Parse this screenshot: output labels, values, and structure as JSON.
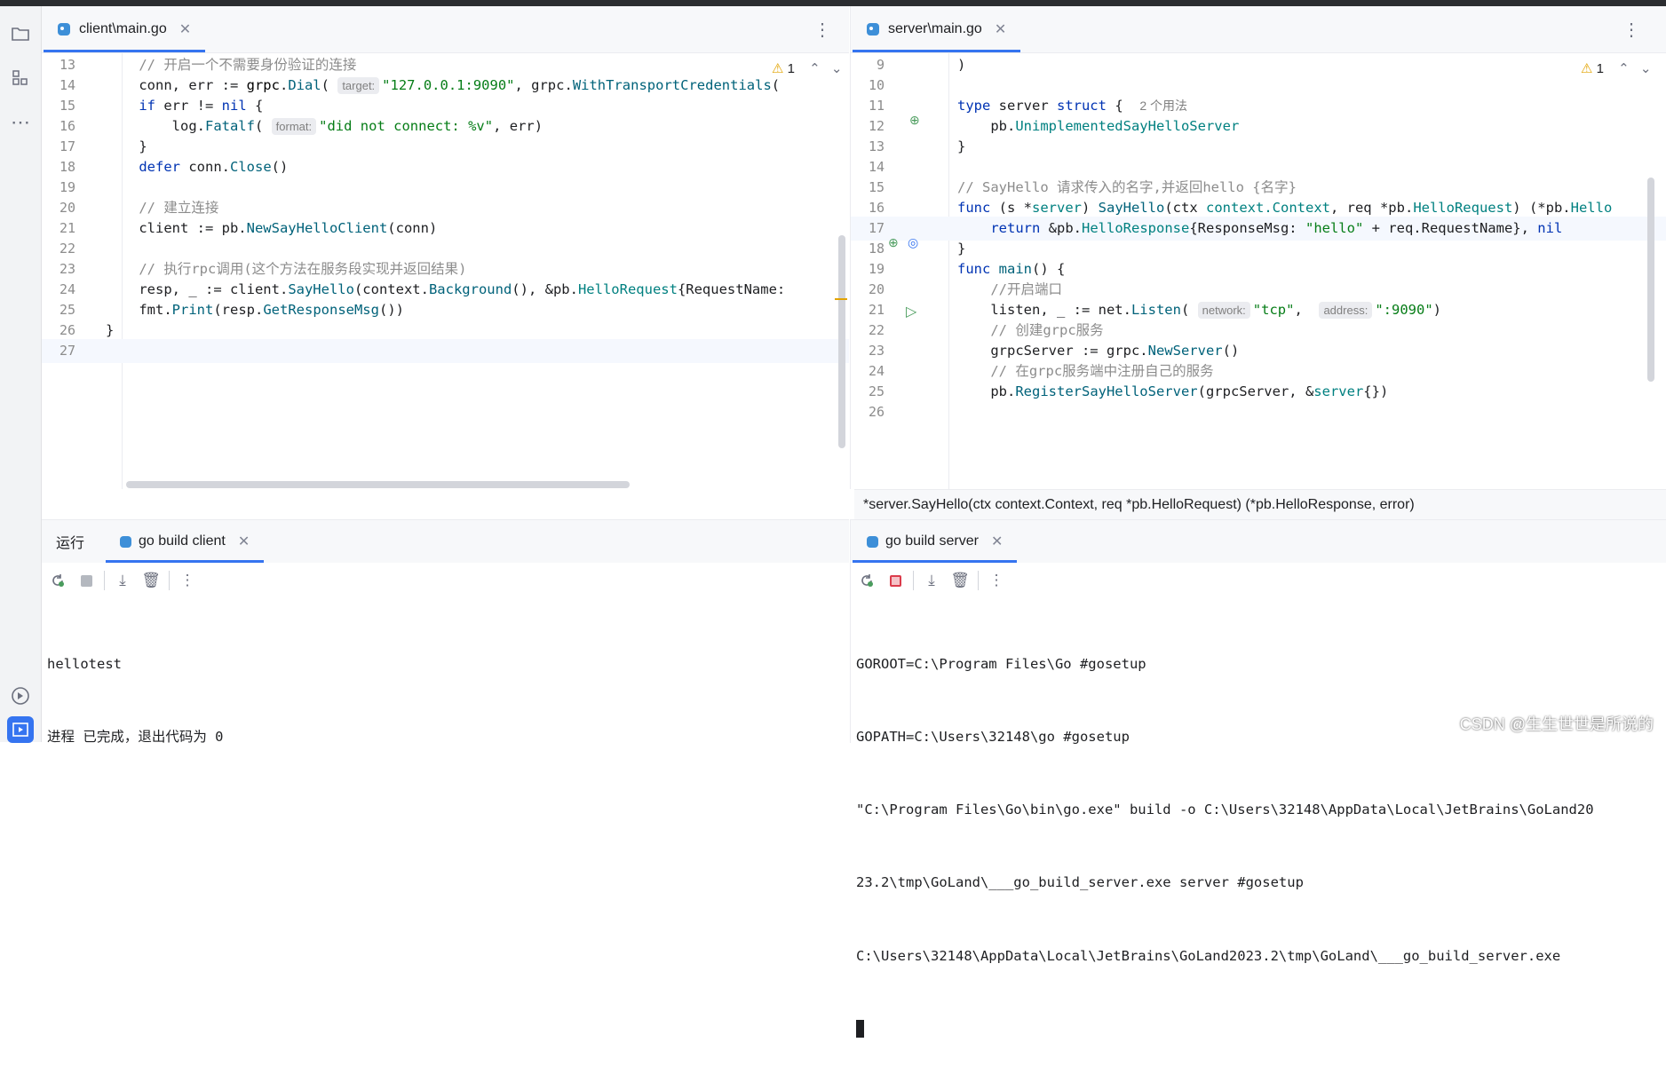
{
  "left_tabs": {
    "active": "client\\main.go"
  },
  "right_tabs": {
    "active": "server\\main.go"
  },
  "left_editor": {
    "warnings": "1",
    "lines": [
      {
        "n": "13",
        "parts": [
          {
            "t": "    ",
            "c": ""
          },
          {
            "t": "// 开启一个不需要身份验证的连接",
            "c": "cm"
          }
        ]
      },
      {
        "n": "14",
        "parts": [
          {
            "t": "    conn, err := ",
            "c": ""
          },
          {
            "t": "grpc",
            "c": "pk"
          },
          {
            "t": ".",
            "c": ""
          },
          {
            "t": "Dial",
            "c": "fn"
          },
          {
            "t": "( ",
            "c": ""
          },
          {
            "h": "target:"
          },
          {
            "t": "\"127.0.0.1:9090\"",
            "c": "str"
          },
          {
            "t": ", grpc.",
            "c": ""
          },
          {
            "t": "WithTransportCredentials",
            "c": "fn"
          },
          {
            "t": "(",
            "c": ""
          }
        ]
      },
      {
        "n": "15",
        "parts": [
          {
            "t": "    ",
            "c": ""
          },
          {
            "t": "if",
            "c": "kw"
          },
          {
            "t": " err != ",
            "c": ""
          },
          {
            "t": "nil",
            "c": "kw"
          },
          {
            "t": " {",
            "c": ""
          }
        ]
      },
      {
        "n": "16",
        "parts": [
          {
            "t": "        log.",
            "c": ""
          },
          {
            "t": "Fatalf",
            "c": "fn"
          },
          {
            "t": "( ",
            "c": ""
          },
          {
            "h": "format:"
          },
          {
            "t": "\"did not connect: %v\"",
            "c": "str"
          },
          {
            "t": ", err)",
            "c": ""
          }
        ]
      },
      {
        "n": "17",
        "parts": [
          {
            "t": "    }",
            "c": ""
          }
        ]
      },
      {
        "n": "18",
        "parts": [
          {
            "t": "    ",
            "c": ""
          },
          {
            "t": "defer",
            "c": "kw"
          },
          {
            "t": " conn.",
            "c": ""
          },
          {
            "t": "Close",
            "c": "fn"
          },
          {
            "t": "()",
            "c": ""
          }
        ]
      },
      {
        "n": "19",
        "parts": []
      },
      {
        "n": "20",
        "parts": [
          {
            "t": "    ",
            "c": ""
          },
          {
            "t": "// 建立连接",
            "c": "cm"
          }
        ]
      },
      {
        "n": "21",
        "parts": [
          {
            "t": "    client := pb.",
            "c": ""
          },
          {
            "t": "NewSayHelloClient",
            "c": "fn"
          },
          {
            "t": "(conn)",
            "c": ""
          }
        ]
      },
      {
        "n": "22",
        "parts": []
      },
      {
        "n": "23",
        "parts": [
          {
            "t": "    ",
            "c": ""
          },
          {
            "t": "// 执行rpc调用(这个方法在服务段实现并返回结果)",
            "c": "cm"
          }
        ]
      },
      {
        "n": "24",
        "parts": [
          {
            "t": "    resp, _ := client.",
            "c": ""
          },
          {
            "t": "SayHello",
            "c": "fn"
          },
          {
            "t": "(context.",
            "c": ""
          },
          {
            "t": "Background",
            "c": "fn"
          },
          {
            "t": "(), &pb.",
            "c": ""
          },
          {
            "t": "HelloRequest",
            "c": "ty"
          },
          {
            "t": "{RequestName:",
            "c": ""
          }
        ]
      },
      {
        "n": "25",
        "parts": [
          {
            "t": "    fmt.",
            "c": ""
          },
          {
            "t": "Print",
            "c": "fn"
          },
          {
            "t": "(resp.",
            "c": ""
          },
          {
            "t": "GetResponseMsg",
            "c": "fn"
          },
          {
            "t": "())",
            "c": ""
          }
        ]
      },
      {
        "n": "26",
        "parts": [
          {
            "t": "}",
            "c": ""
          }
        ]
      },
      {
        "n": "27",
        "parts": [],
        "current": true
      }
    ]
  },
  "right_editor": {
    "warnings": "1",
    "lines": [
      {
        "n": "9",
        "parts": [
          {
            "t": ")",
            "c": ""
          }
        ]
      },
      {
        "n": "10",
        "parts": []
      },
      {
        "n": "11",
        "parts": [
          {
            "t": "type",
            "c": "kw"
          },
          {
            "t": " server ",
            "c": ""
          },
          {
            "t": "struct",
            "c": "kw"
          },
          {
            "t": " {  ",
            "c": ""
          },
          {
            "u": "2 个用法"
          }
        ]
      },
      {
        "n": "12",
        "parts": [
          {
            "t": "    pb.",
            "c": ""
          },
          {
            "t": "UnimplementedSayHelloServer",
            "c": "ty"
          }
        ]
      },
      {
        "n": "13",
        "parts": [
          {
            "t": "}",
            "c": ""
          }
        ]
      },
      {
        "n": "14",
        "parts": []
      },
      {
        "n": "15",
        "parts": [
          {
            "t": "// SayHello 请求传入的名字,并返回hello {名字}",
            "c": "cm"
          }
        ]
      },
      {
        "n": "16",
        "parts": [
          {
            "t": "func",
            "c": "kw"
          },
          {
            "t": " (s *",
            "c": ""
          },
          {
            "t": "server",
            "c": "ty"
          },
          {
            "t": ") ",
            "c": ""
          },
          {
            "t": "SayHello",
            "c": "fn"
          },
          {
            "t": "(ctx ",
            "c": ""
          },
          {
            "t": "context.Context",
            "c": "ty"
          },
          {
            "t": ", req *pb.",
            "c": ""
          },
          {
            "t": "HelloRequest",
            "c": "ty"
          },
          {
            "t": ") (*pb.",
            "c": ""
          },
          {
            "t": "Hello",
            "c": "ty"
          }
        ]
      },
      {
        "n": "17",
        "parts": [
          {
            "t": "    ",
            "c": ""
          },
          {
            "t": "return",
            "c": "kw"
          },
          {
            "t": " &pb.",
            "c": ""
          },
          {
            "t": "HelloResponse",
            "c": "ty"
          },
          {
            "t": "{ResponseMsg: ",
            "c": ""
          },
          {
            "t": "\"hello\"",
            "c": "str"
          },
          {
            "t": " + req.RequestName}, ",
            "c": ""
          },
          {
            "t": "nil",
            "c": "kw"
          }
        ],
        "current": true
      },
      {
        "n": "18",
        "parts": [
          {
            "t": "}",
            "c": ""
          }
        ]
      },
      {
        "n": "19",
        "parts": [
          {
            "t": "func",
            "c": "kw"
          },
          {
            "t": " ",
            "c": ""
          },
          {
            "t": "main",
            "c": "fn"
          },
          {
            "t": "() {",
            "c": ""
          }
        ]
      },
      {
        "n": "20",
        "parts": [
          {
            "t": "    ",
            "c": ""
          },
          {
            "t": "//开启端口",
            "c": "cm"
          }
        ]
      },
      {
        "n": "21",
        "parts": [
          {
            "t": "    listen, _ := net.",
            "c": ""
          },
          {
            "t": "Listen",
            "c": "fn"
          },
          {
            "t": "( ",
            "c": ""
          },
          {
            "h": "network:"
          },
          {
            "t": "\"tcp\"",
            "c": "str"
          },
          {
            "t": ",  ",
            "c": ""
          },
          {
            "h": "address:"
          },
          {
            "t": "\":9090\"",
            "c": "str"
          },
          {
            "t": ")",
            "c": ""
          }
        ]
      },
      {
        "n": "22",
        "parts": [
          {
            "t": "    ",
            "c": ""
          },
          {
            "t": "// 创建grpc服务",
            "c": "cm"
          }
        ]
      },
      {
        "n": "23",
        "parts": [
          {
            "t": "    grpcServer := grpc.",
            "c": ""
          },
          {
            "t": "NewServer",
            "c": "fn"
          },
          {
            "t": "()",
            "c": ""
          }
        ]
      },
      {
        "n": "24",
        "parts": [
          {
            "t": "    ",
            "c": ""
          },
          {
            "t": "// 在grpc服务端中注册自己的服务",
            "c": "cm"
          }
        ]
      },
      {
        "n": "25",
        "parts": [
          {
            "t": "    pb.",
            "c": ""
          },
          {
            "t": "RegisterSayHelloServer",
            "c": "fn"
          },
          {
            "t": "(grpcServer, &",
            "c": ""
          },
          {
            "t": "server",
            "c": "ty"
          },
          {
            "t": "{})",
            "c": ""
          }
        ]
      },
      {
        "n": "26",
        "parts": []
      }
    ],
    "breadcrumb": "*server.SayHello(ctx context.Context, req *pb.HelloRequest) (*pb.HelloResponse, error)"
  },
  "run_left": {
    "panel_title": "运行",
    "tab": "go build client",
    "output": [
      "hellotest",
      "进程 已完成，退出代码为 0"
    ]
  },
  "run_right": {
    "tab": "go build server",
    "output": [
      "GOROOT=C:\\Program Files\\Go #gosetup",
      "GOPATH=C:\\Users\\32148\\go #gosetup",
      "\"C:\\Program Files\\Go\\bin\\go.exe\" build -o C:\\Users\\32148\\AppData\\Local\\JetBrains\\GoLand20",
      "23.2\\tmp\\GoLand\\___go_build_server.exe server #gosetup",
      "C:\\Users\\32148\\AppData\\Local\\JetBrains\\GoLand2023.2\\tmp\\GoLand\\___go_build_server.exe"
    ]
  },
  "watermark": "CSDN @生生世世是所说的",
  "colors": {
    "accent": "#3574f0",
    "keyword": "#0033b3",
    "string": "#067d17",
    "comment": "#8c8c8c",
    "function": "#00627a"
  }
}
